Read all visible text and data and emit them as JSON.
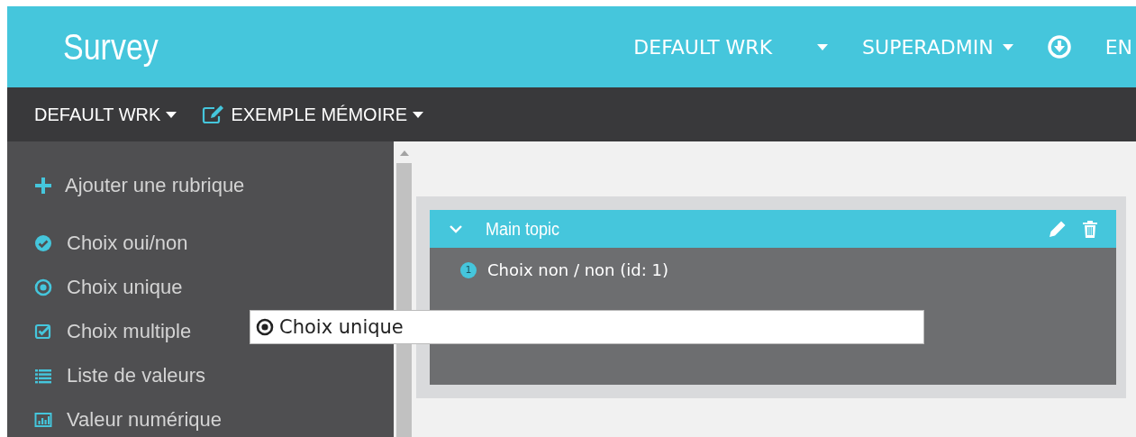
{
  "app": {
    "title": "Survey"
  },
  "top_nav": [
    {
      "label": "DEFAULT WRK",
      "kind": "dropdown"
    },
    {
      "label": "SUPERADMIN",
      "kind": "dropdown"
    },
    {
      "kind": "download-icon"
    },
    {
      "label": "EN",
      "kind": "link"
    }
  ],
  "breadcrumb": [
    {
      "label": "DEFAULT WRK",
      "kind": "plain"
    },
    {
      "label": "EXEMPLE MÉMOIRE",
      "kind": "edit"
    }
  ],
  "sidebar": {
    "add_item": {
      "label": "Ajouter une rubrique"
    },
    "items": [
      {
        "label": "Choix oui/non",
        "kind": "yesno"
      },
      {
        "label": "Choix unique",
        "kind": "single"
      },
      {
        "label": "Choix multiple",
        "kind": "multiple"
      },
      {
        "label": "Liste de valeurs",
        "kind": "list"
      },
      {
        "label": "Valeur numérique",
        "kind": "numeric"
      }
    ]
  },
  "topic": {
    "title": "Main topic",
    "expanded": true,
    "questions": [
      {
        "number": "1",
        "label": "Choix non / non (id: 1)"
      }
    ]
  },
  "drag_ghost": {
    "label": "Choix unique",
    "kind": "single"
  }
}
